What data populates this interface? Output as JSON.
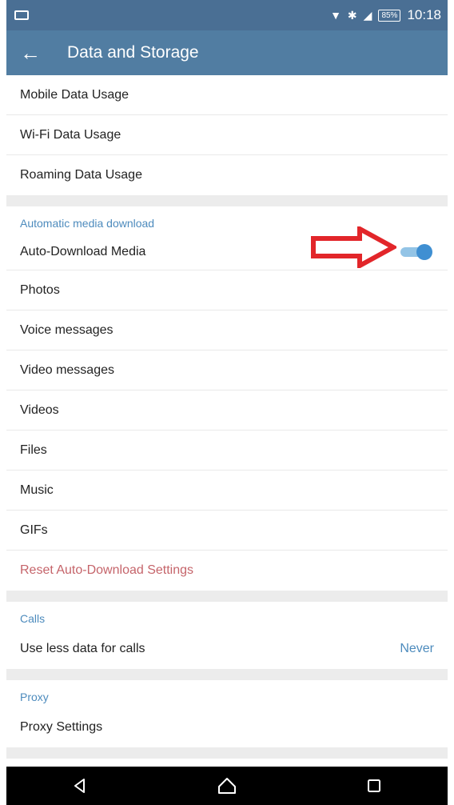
{
  "status_bar": {
    "battery": "85%",
    "time": "10:18",
    "icons": [
      "notification-icon",
      "mail-icon",
      "bluetooth-icon",
      "signal-icon",
      "battery-icon"
    ]
  },
  "app_bar": {
    "title": "Data and Storage",
    "back_icon": "back-arrow-icon"
  },
  "data_usage": {
    "items": [
      {
        "label": "Mobile Data Usage"
      },
      {
        "label": "Wi-Fi Data Usage"
      },
      {
        "label": "Roaming Data Usage"
      }
    ]
  },
  "auto_download": {
    "header": "Automatic media download",
    "toggle_label": "Auto-Download Media",
    "toggle_on": true,
    "items": [
      {
        "label": "Photos"
      },
      {
        "label": "Voice messages"
      },
      {
        "label": "Video messages"
      },
      {
        "label": "Videos"
      },
      {
        "label": "Files"
      },
      {
        "label": "Music"
      },
      {
        "label": "GIFs"
      }
    ],
    "reset_label": "Reset Auto-Download Settings"
  },
  "calls": {
    "header": "Calls",
    "item": {
      "label": "Use less data for calls",
      "value": "Never"
    }
  },
  "proxy": {
    "header": "Proxy",
    "item": {
      "label": "Proxy Settings"
    }
  },
  "annotation": {
    "icon": "red-arrow-icon",
    "color": "#e2262a"
  },
  "colors": {
    "status_bar": "#4a6f94",
    "app_bar": "#517da2",
    "accent": "#4d8bbd",
    "reset_text": "#c5646a",
    "toggle_thumb": "#3f8fd2",
    "toggle_track": "#93c4e6"
  },
  "nav_bar": {
    "buttons": [
      "back-triangle-icon",
      "home-icon",
      "recents-icon"
    ]
  }
}
